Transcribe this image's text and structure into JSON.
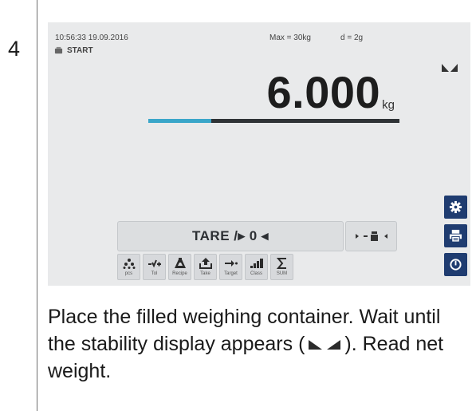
{
  "step": "4",
  "status": {
    "datetime": "10:56:33 19.09.2016",
    "max": "Max = 30kg",
    "d": "d = 2g",
    "program": "START"
  },
  "weight": {
    "value": "6.000",
    "unit": "kg",
    "capacity_used": 0.25
  },
  "tare": {
    "label": "TARE /▸ 0 ◂"
  },
  "apps": [
    {
      "label": "pcs",
      "icon": "pieces-icon"
    },
    {
      "label": "Tol",
      "icon": "tolerance-icon"
    },
    {
      "label": "Recipe",
      "icon": "flask-icon"
    },
    {
      "label": "Take",
      "icon": "take-icon"
    },
    {
      "label": "Target",
      "icon": "target-arrow-icon"
    },
    {
      "label": "Class",
      "icon": "class-bars-icon"
    },
    {
      "label": "SUM",
      "icon": "sum-icon"
    }
  ],
  "side_menu": [
    "settings-gear-icon",
    "printer-icon",
    "power-icon"
  ],
  "instruction": {
    "part1": "Place the filled weighing container. Wait until the stability display appears (",
    "part2": "). Read net weight."
  },
  "colors": {
    "screen_bg": "#e9eaeb",
    "progress_fill": "#3aa6c9",
    "progress_track": "#2f3336",
    "side_button": "#1f3c70"
  }
}
